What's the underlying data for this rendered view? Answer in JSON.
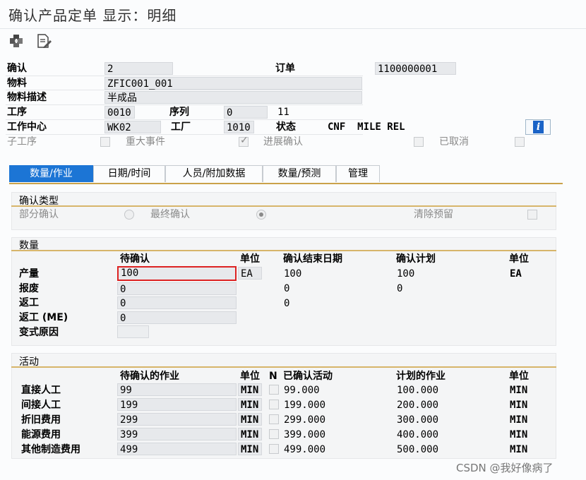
{
  "window": {
    "title": "确认产品定单 显示：明细"
  },
  "toolbar": {
    "icons": [
      "puzzle-tool-icon",
      "document-edit-icon"
    ]
  },
  "header": {
    "confirmation_label": "确认",
    "confirmation_value": "2",
    "order_label": "订单",
    "order_value": "1100000001",
    "material_label": "物料",
    "material_value": "ZFIC001_001",
    "material_desc_label": "物料描述",
    "material_desc_value": "半成品",
    "operation_label": "工序",
    "operation_value": "0010",
    "sequence_label": "序列",
    "sequence_value": "0",
    "sequence_extra": "11",
    "workcenter_label": "工作中心",
    "workcenter_value": "WK02",
    "plant_label": "工厂",
    "plant_value": "1010",
    "status_label": "状态",
    "status_value": "CNF  MILE REL",
    "info_button": "i"
  },
  "flags": {
    "sub_operation": "子工序",
    "major_event": "重大事件",
    "progress_confirm": "进展确认",
    "cancelled": "已取消"
  },
  "tabs": [
    "数量/作业",
    "日期/时间",
    "人员/附加数据",
    "数量/预测",
    "管理"
  ],
  "confirm_type": {
    "title": "确认类型",
    "partial": "部分确认",
    "final": "最终确认",
    "clear_reservation": "清除预留"
  },
  "quantity": {
    "title": "数量",
    "col_to_confirm": "待确认",
    "col_unit": "单位",
    "col_end_date": "确认结束日期",
    "col_plan": "确认计划",
    "col_unit2": "单位",
    "rows": [
      {
        "label": "产量",
        "value": "100",
        "unit": "EA",
        "confirmed": "100",
        "plan": "100",
        "unit2": "EA"
      },
      {
        "label": "报废",
        "value": "0",
        "confirmed": "0",
        "plan": "0"
      },
      {
        "label": "返工",
        "value": "0",
        "confirmed": "0"
      },
      {
        "label": "返工 (ME)",
        "value": "0"
      },
      {
        "label": "变式原因",
        "value": ""
      }
    ]
  },
  "activities": {
    "title": "活动",
    "col_to_confirm": "待确认的作业",
    "col_unit": "单位",
    "col_n": "N",
    "col_confirmed": "已确认活动",
    "col_planned": "计划的作业",
    "col_unit2": "单位",
    "rows": [
      {
        "label": "直接人工",
        "value": "99",
        "unit": "MIN",
        "confirmed": "99.000",
        "planned": "100.000",
        "unit2": "MIN"
      },
      {
        "label": "间接人工",
        "value": "199",
        "unit": "MIN",
        "confirmed": "199.000",
        "planned": "200.000",
        "unit2": "MIN"
      },
      {
        "label": "折旧费用",
        "value": "299",
        "unit": "MIN",
        "confirmed": "299.000",
        "planned": "300.000",
        "unit2": "MIN"
      },
      {
        "label": "能源费用",
        "value": "399",
        "unit": "MIN",
        "confirmed": "399.000",
        "planned": "400.000",
        "unit2": "MIN"
      },
      {
        "label": "其他制造费用",
        "value": "499",
        "unit": "MIN",
        "confirmed": "499.000",
        "planned": "500.000",
        "unit2": "MIN"
      }
    ]
  },
  "watermark": "CSDN @我好像病了"
}
